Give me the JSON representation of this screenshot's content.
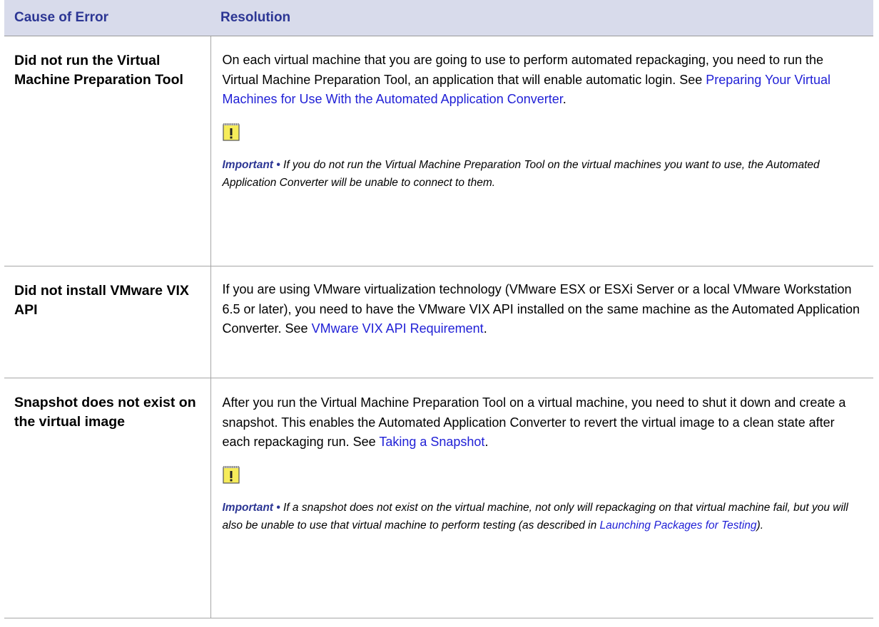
{
  "table": {
    "headers": {
      "cause": "Cause of Error",
      "resolution": "Resolution"
    },
    "rows": [
      {
        "cause": "Did not run the Virtual Machine Preparation Tool",
        "text_before_link": "On each virtual machine that you are going to use to perform automated repackaging, you need to run the Virtual Machine Preparation Tool, an application that will enable automatic login. See ",
        "link": "Preparing Your Virtual Machines for Use With the Automated Application Converter",
        "text_after_link": ".",
        "note_label": "Important •",
        "note_text": " If you do not run the Virtual Machine Preparation Tool on the virtual machines you want to use, the Automated Application Converter will be unable to connect to them."
      },
      {
        "cause": "Did not install VMware VIX API",
        "text_before_link": "If you are using VMware virtualization technology (VMware ESX or ESXi Server or a local VMware Workstation 6.5 or later), you need to have the VMware VIX API installed on the same machine as the Automated Application Converter. See ",
        "link": "VMware VIX API Requirement",
        "text_after_link": "."
      },
      {
        "cause": "Snapshot does not exist on the virtual image",
        "text_before_link": "After you run the Virtual Machine Preparation Tool on a virtual machine, you need to shut it down and create a snapshot. This enables the Automated Application Converter to revert the virtual image to a clean state after each repackaging run. See ",
        "link": "Taking a Snapshot",
        "text_after_link": ".",
        "note_label": "Important •",
        "note_text_before_link": " If a snapshot does not exist on the virtual machine, not only will repackaging on that virtual machine fail, but you will also be unable to use that virtual machine to perform testing (as described in ",
        "note_link": "Launching Packages for Testing",
        "note_text_after_link": ")."
      }
    ]
  },
  "icons": {
    "note": "important-notepad-icon"
  },
  "colors": {
    "header_bg": "#d8dbeb",
    "header_text": "#2c3694",
    "link": "#1f1fd6",
    "note_label": "#2c3694",
    "icon_fill": "#f6ec5a"
  }
}
